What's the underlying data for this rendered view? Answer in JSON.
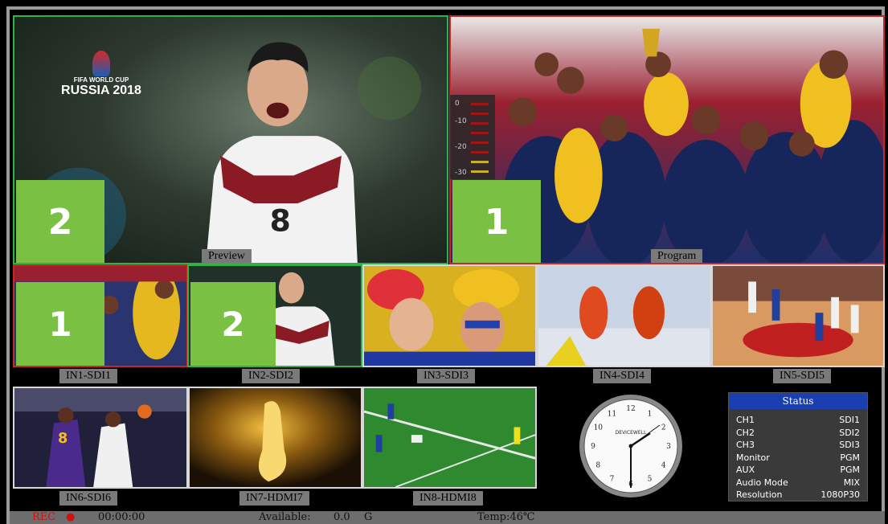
{
  "preview": {
    "label": "Preview",
    "number": "2",
    "logo_line1": "FIFA WORLD CUP",
    "logo_line2": "RUSSIA 2018",
    "jersey": "8"
  },
  "program": {
    "label": "Program",
    "number": "1"
  },
  "vu_meter": {
    "ticks": [
      "0",
      "-10",
      "-20",
      "-30"
    ]
  },
  "inputs": [
    {
      "label": "IN1-SDI1",
      "number": "1"
    },
    {
      "label": "IN2-SDI2",
      "number": "2"
    },
    {
      "label": "IN3-SDI3"
    },
    {
      "label": "IN4-SDI4"
    },
    {
      "label": "IN5-SDI5"
    },
    {
      "label": "IN6-SDI6",
      "jersey": "8"
    },
    {
      "label": "IN7-HDMI7"
    },
    {
      "label": "IN8-HDMI8"
    }
  ],
  "clock": {
    "brand": "DEVICEWELL",
    "numbers": [
      "12",
      "1",
      "2",
      "3",
      "4",
      "5",
      "6",
      "7",
      "8",
      "9",
      "10",
      "11"
    ]
  },
  "status": {
    "title": "Status",
    "rows": [
      {
        "key": "CH1",
        "value": "SDI1"
      },
      {
        "key": "CH2",
        "value": "SDI2"
      },
      {
        "key": "CH3",
        "value": "SDI3"
      },
      {
        "key": "Monitor",
        "value": "PGM"
      },
      {
        "key": "AUX",
        "value": "PGM"
      },
      {
        "key": "Audio Mode",
        "value": "MIX"
      },
      {
        "key": "Resolution",
        "value": "1080P30"
      }
    ]
  },
  "bottom": {
    "rec_label": "REC",
    "rec_dot": "●",
    "timecode": "00:00:00",
    "available_label": "Available:",
    "available_value": "0.0",
    "available_unit": "G",
    "temperature": "Temp:46℃"
  },
  "colors": {
    "preview_border": "#2fb24a",
    "program_border": "#c62828",
    "badge": "#7ac143",
    "status_header": "#1a3fb0"
  }
}
